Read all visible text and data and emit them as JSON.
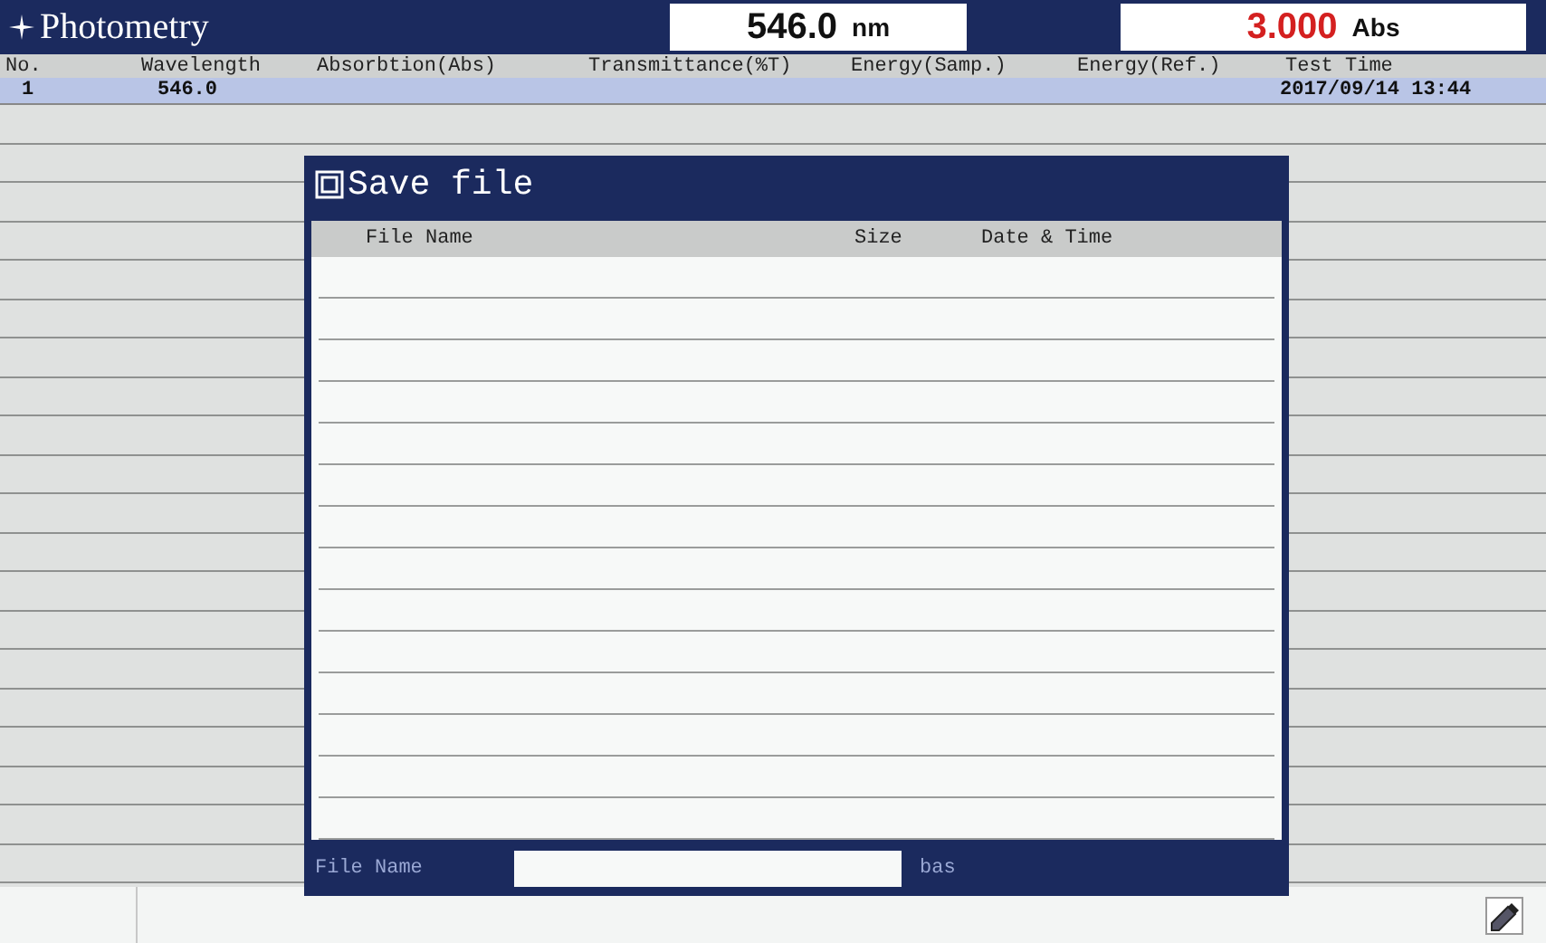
{
  "window": {
    "title": "Photometry"
  },
  "readouts": [
    {
      "kind": "wavelength",
      "value": "546.0",
      "unit": "nm"
    },
    {
      "kind": "absorbance",
      "value": "3.000",
      "unit": "Abs"
    }
  ],
  "table": {
    "columns": [
      "No.",
      "Wavelength",
      "Absorbtion(Abs)",
      "Transmittance(%T)",
      "Energy(Samp.)",
      "Energy(Ref.)",
      "Test Time"
    ],
    "rows": [
      {
        "no": "1",
        "wavelength": "546.0",
        "test_time": "2017/09/14 13:44",
        "selected": true
      }
    ]
  },
  "dialog": {
    "title": "Save file",
    "columns": [
      "File Name",
      "Size",
      "Date & Time"
    ],
    "file_name_label": "File Name",
    "extension": "bas"
  }
}
